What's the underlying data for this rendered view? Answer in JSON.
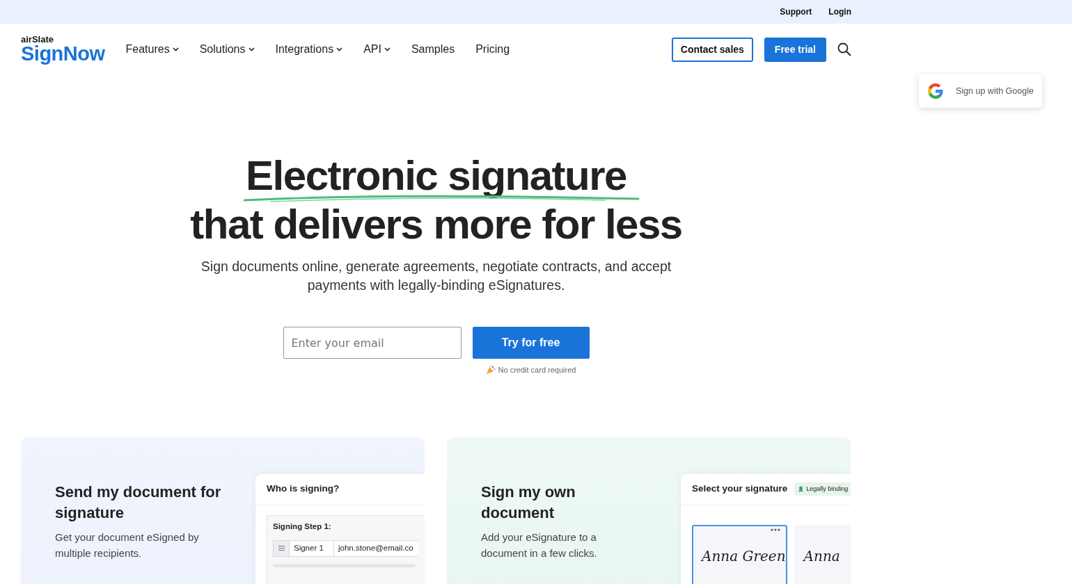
{
  "top_bar": {
    "links": [
      "Support",
      "Login"
    ]
  },
  "logo": {
    "small": "airSlate",
    "main": "SignNow"
  },
  "nav": [
    {
      "label": "Features",
      "dropdown": true
    },
    {
      "label": "Solutions",
      "dropdown": true
    },
    {
      "label": "Integrations",
      "dropdown": true
    },
    {
      "label": "API",
      "dropdown": true
    },
    {
      "label": "Samples",
      "dropdown": false
    },
    {
      "label": "Pricing",
      "dropdown": false
    }
  ],
  "nav_buttons": [
    {
      "label": "Contact sales",
      "kind": "outline"
    },
    {
      "label": "Free trial",
      "kind": "primary"
    }
  ],
  "google_popup": {
    "label": "Sign up with Google"
  },
  "hero": {
    "title_lines": [
      "Electronic signature",
      "that delivers more for less"
    ],
    "subtitle": "Sign documents online, generate agreements, negotiate contracts, and accept payments with legally-binding eSignatures.",
    "email": {
      "placeholder": "Enter your email"
    },
    "button": "Try for free",
    "note": "No credit card required"
  },
  "cards": [
    {
      "kind": "send",
      "title": "Send my document for signature",
      "description": "Get your document eSigned by multiple recipients.",
      "preview": {
        "heading": "Who is signing?",
        "step": "Signing Step 1:",
        "signer": "Signer 1",
        "email": "john.stone@email.co"
      }
    },
    {
      "kind": "sign",
      "title": "Sign my own document",
      "description": "Add your eSignature to a document in a few clicks.",
      "preview": {
        "heading": "Select your signature",
        "badge": "Legally binding",
        "signatures": [
          {
            "text": "Anna Green",
            "selected": true
          },
          {
            "text": "Anna",
            "selected": false
          }
        ]
      }
    }
  ]
}
